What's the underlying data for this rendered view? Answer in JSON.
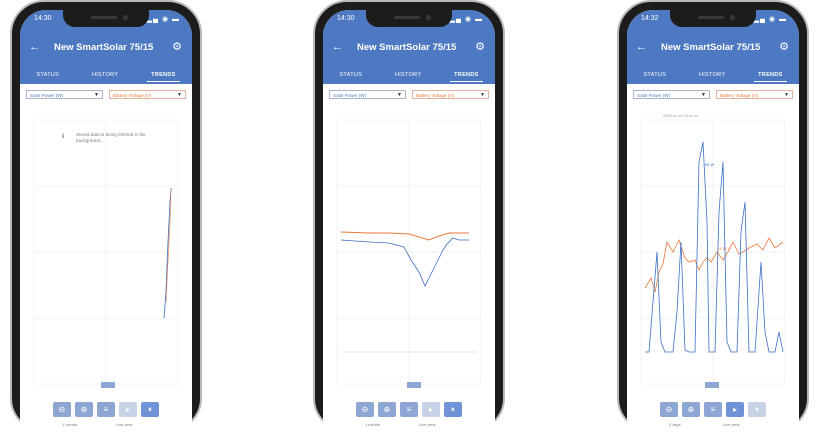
{
  "app": {
    "title": "New SmartSolar 75/15",
    "tabs": [
      "STATUS",
      "HISTORY",
      "TRENDS"
    ],
    "active_tab": "TRENDS",
    "left_selector": "Solar Power (W)",
    "right_selector": "Battery Voltage (V)",
    "colors": {
      "header": "#4d79c2",
      "solar": "#3d6fc4",
      "battery": "#e77a3c"
    }
  },
  "phones": [
    {
      "time": "14:30",
      "loading_message": "Stored data is being fetched in the background...",
      "zoom_label": "1 minute",
      "mode_label": "Live view",
      "play_icon": "pause-icon"
    },
    {
      "time": "14:30",
      "zoom_label": "1 minute",
      "mode_label": "Live view",
      "play_icon": "pause-icon"
    },
    {
      "time": "14:32",
      "tooltip": "2020-xx-xx 10:xx:xx",
      "point_labels": [
        "56 W",
        "14.32 V"
      ],
      "zoom_label": "3 days",
      "mode_label": "Live view",
      "play_icon": "play-icon"
    }
  ]
}
